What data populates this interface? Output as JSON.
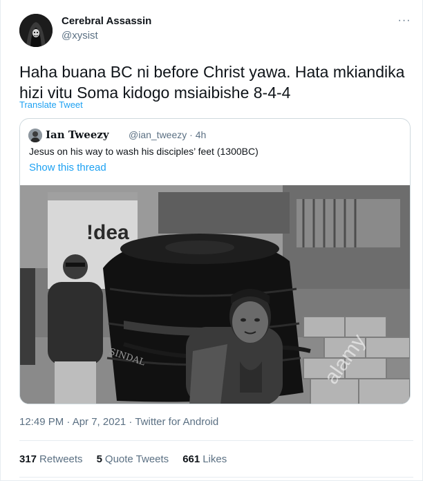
{
  "author": {
    "display_name": "Cerebral Assassin",
    "handle": "@xysist"
  },
  "tweet": {
    "text": "Haha buana BC ni before Christ yawa. Hata mkiandika hizi vitu Soma kidogo msiaibishe 8-4-4",
    "translate_label": "Translate Tweet",
    "more_icon": "···"
  },
  "quoted": {
    "display_name": "Ian Tweezy",
    "meta": "@ian_tweezy · 4h",
    "text": "Jesus on his way to wash his disciples’ feet (1300BC)",
    "thread_label": "Show this thread",
    "photo": {
      "sign_text": "!dea",
      "tank_brand": "SINDAL",
      "watermark": "alamy"
    }
  },
  "footer": {
    "timestamp": "12:49 PM · Apr 7, 2021 · Twitter for Android",
    "retweets_count": "317",
    "retweets_label": "Retweets",
    "quotes_count": "5",
    "quotes_label": "Quote Tweets",
    "likes_count": "661",
    "likes_label": "Likes"
  },
  "colors": {
    "link": "#1da1f2",
    "secondary_text": "#5b7083",
    "primary_text": "#0f1419"
  }
}
